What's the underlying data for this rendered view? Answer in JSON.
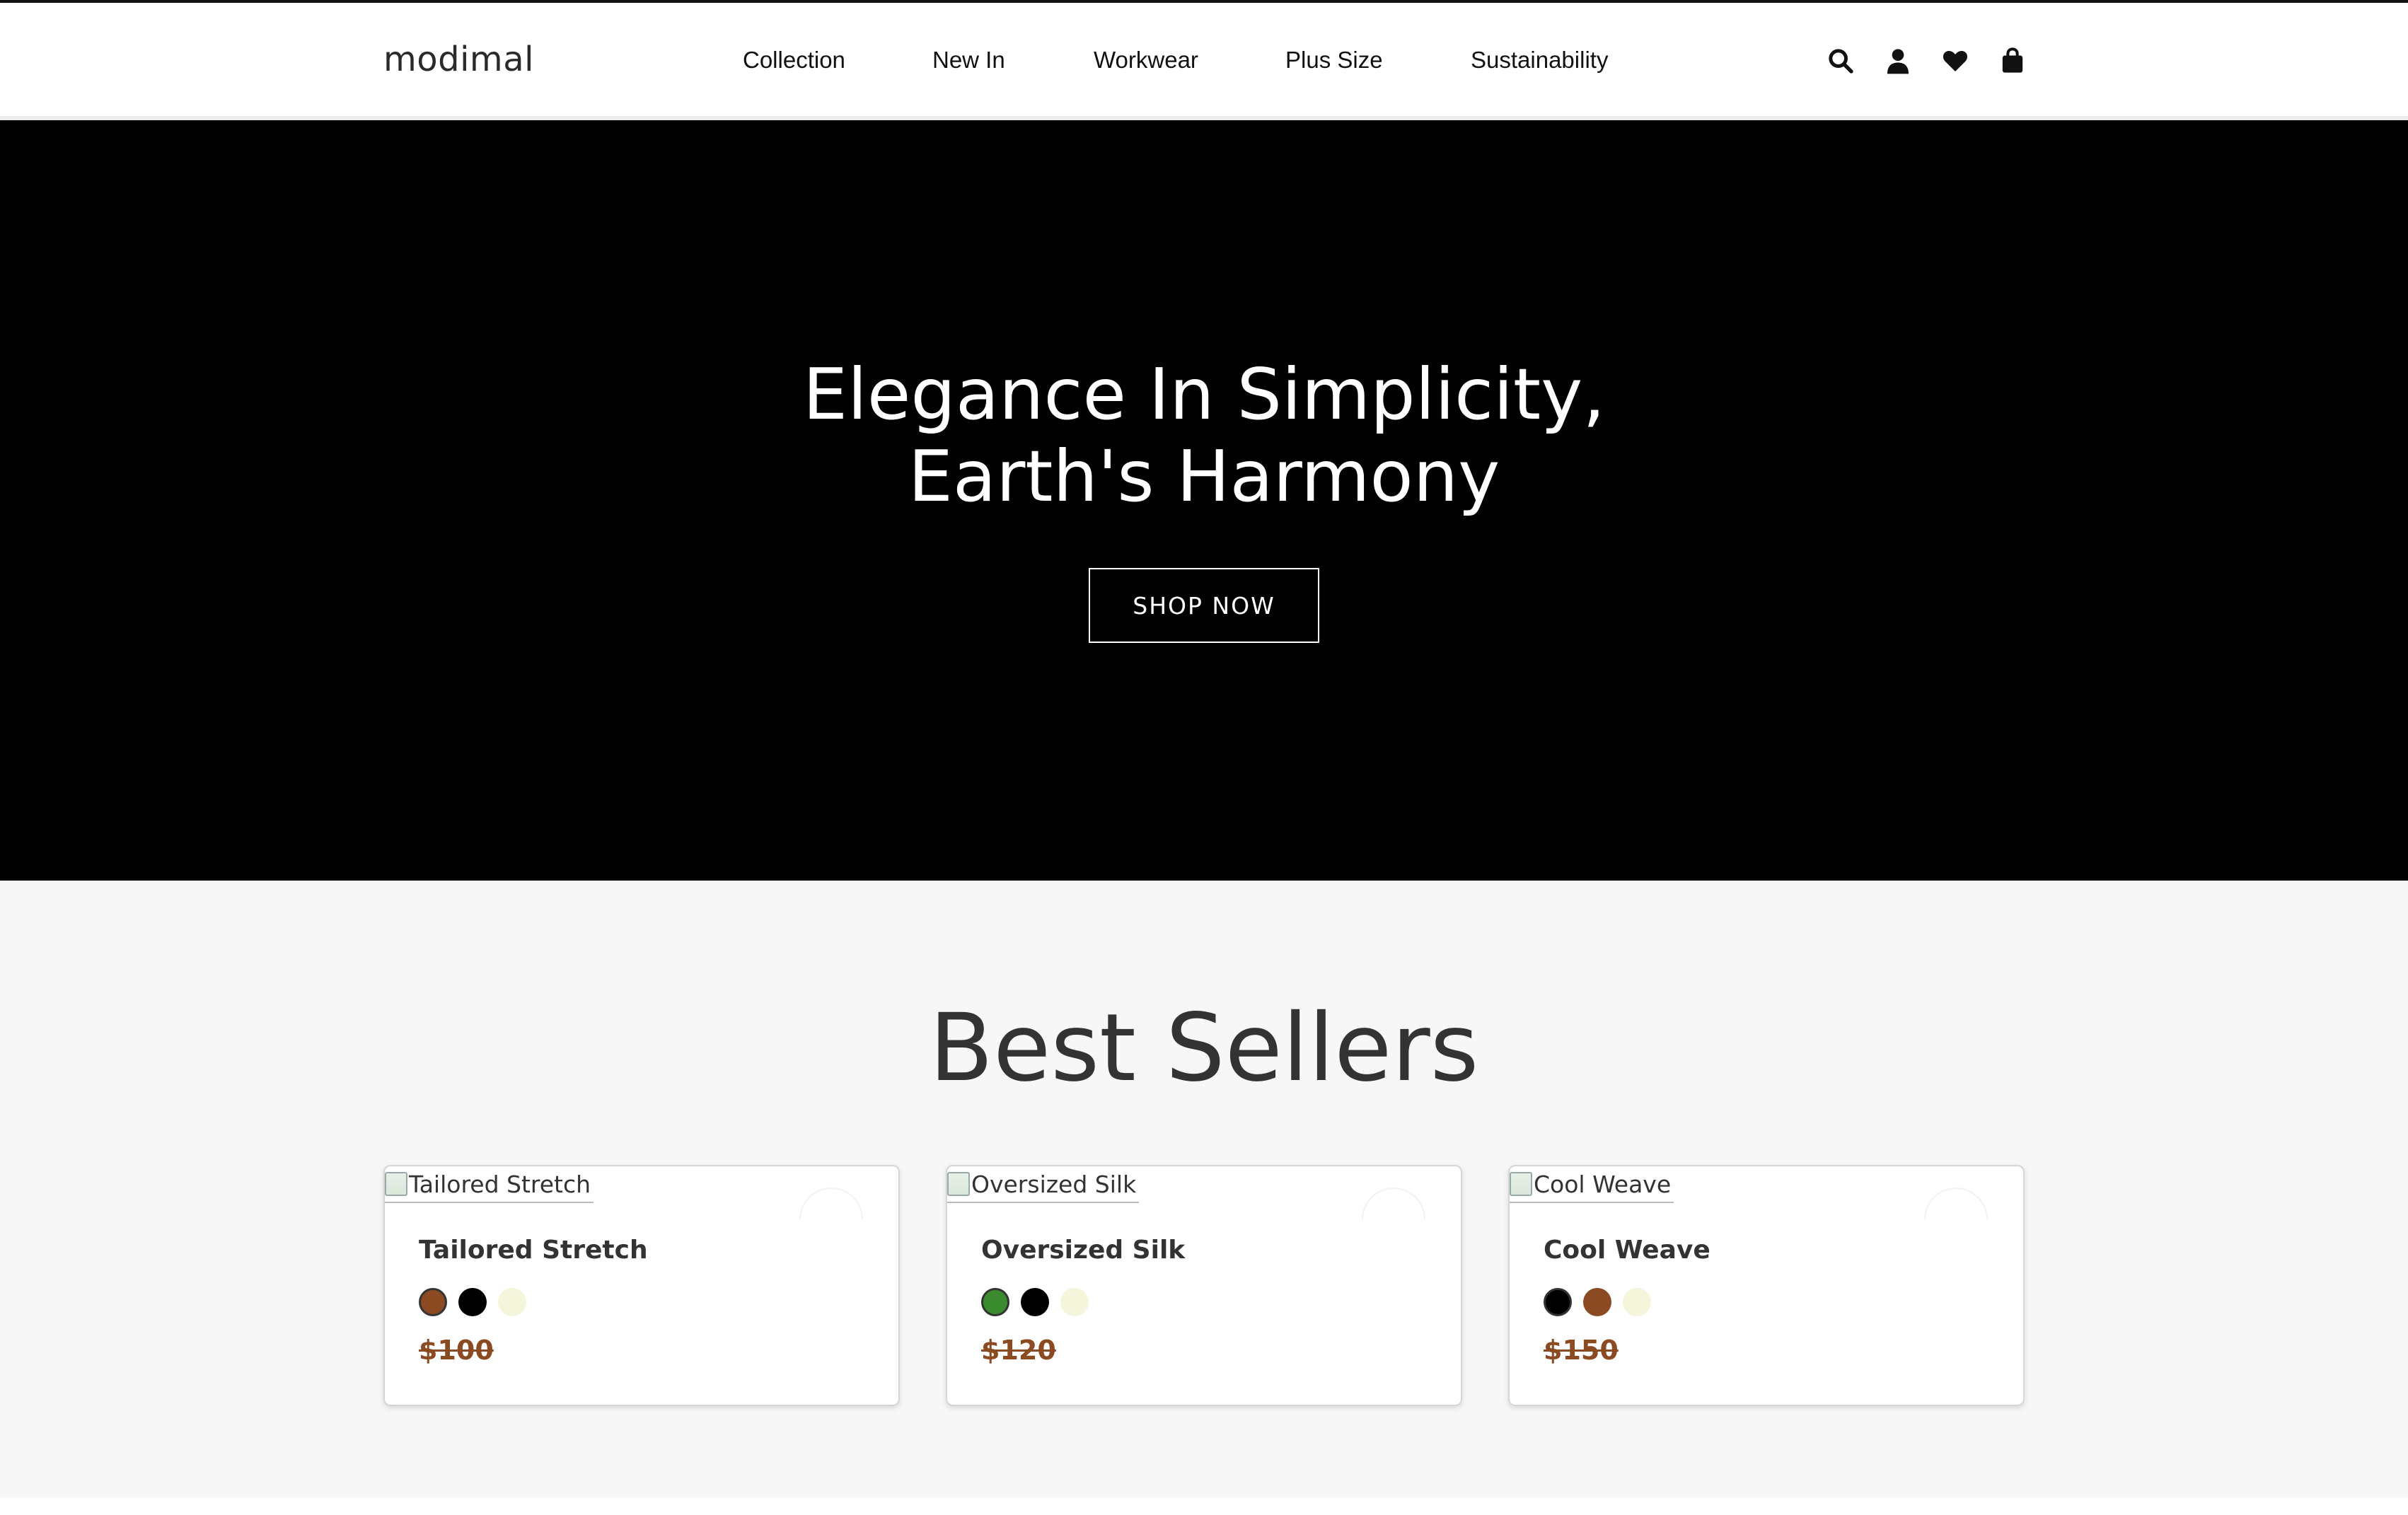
{
  "brand": {
    "logo": "modimal"
  },
  "nav": {
    "items": [
      {
        "label": "Collection"
      },
      {
        "label": "New In"
      },
      {
        "label": "Workwear"
      },
      {
        "label": "Plus Size"
      },
      {
        "label": "Sustainability"
      }
    ]
  },
  "header_icons": [
    "search-icon",
    "user-icon",
    "heart-icon",
    "shopping-bag-icon"
  ],
  "hero": {
    "title_line1": "Elegance In Simplicity,",
    "title_line2": "Earth's Harmony",
    "cta": "SHOP NOW",
    "background": "#000000"
  },
  "best_sellers": {
    "title": "Best Sellers",
    "products": [
      {
        "image_alt": "Tailored Stretch",
        "name": "Tailored Stretch",
        "price": "$100",
        "colors": [
          "#8b4a22",
          "#000000",
          "#f5f5dc"
        ]
      },
      {
        "image_alt": "Oversized Silk",
        "name": "Oversized Silk",
        "price": "$120",
        "colors": [
          "#3a8a2e",
          "#000000",
          "#f5f5dc"
        ]
      },
      {
        "image_alt": "Cool Weave",
        "name": "Cool Weave",
        "price": "$150",
        "colors": [
          "#000000",
          "#8b4a22",
          "#f5f5dc"
        ]
      }
    ]
  },
  "colors": {
    "accent_price": "#8b4a22",
    "section_bg": "#f7f7f7"
  }
}
